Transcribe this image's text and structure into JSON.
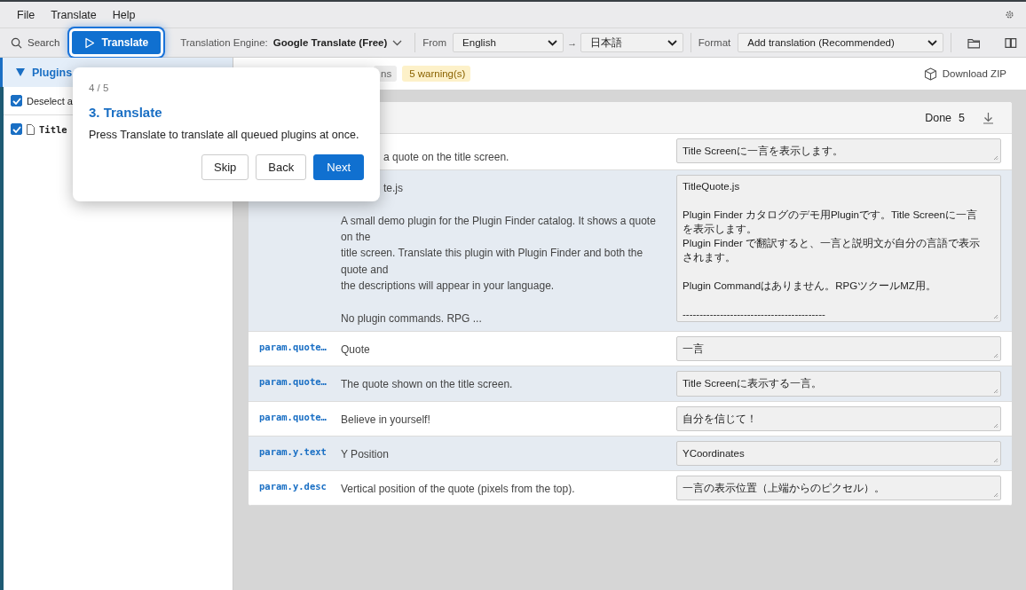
{
  "menu": [
    "File",
    "Translate",
    "Help"
  ],
  "toolbar": {
    "search": "Search",
    "translate": "Translate",
    "engine_label": "Translation Engine:",
    "engine": "Google Translate (Free)",
    "from_label": "From",
    "from": "English",
    "arrow": "→",
    "to": "日本語",
    "format_label": "Format",
    "format": "Add translation (Recommended)"
  },
  "sidebar": {
    "title": "Plugins",
    "expanded": true,
    "items": [
      {
        "label": "Deselect a",
        "checked": true,
        "kind": "toggle"
      },
      {
        "label": "Title",
        "checked": true,
        "kind": "file"
      }
    ]
  },
  "summary": {
    "chips": [
      {
        "label": "ns",
        "kind": "neutral"
      },
      {
        "label": "5 warning(s)",
        "kind": "warning"
      }
    ],
    "download": "Download ZIP"
  },
  "card": {
    "status": "Done",
    "count": "5",
    "rows": [
      {
        "key": "",
        "source": "a quote on the title screen.",
        "translation": "Title Screenに一言を表示します。"
      },
      {
        "key": "",
        "source": "te.js\n\nA small demo plugin for the Plugin Finder catalog. It shows a quote\non the\ntitle screen. Translate this plugin with Plugin Finder and both the\nquote and\nthe descriptions will appear in your language.\n\nNo plugin commands. RPG ...",
        "translation": "TitleQuote.js\n\nPlugin Finder カタログのデモ用Pluginです。Title Screenに一言を表示します。\nPlugin Finder で翻訳すると、一言と説明文が自分の言語で表示されます。\n\nPlugin Commandはありません。RPGツクールMZ用。\n\n------------------------------------------"
      },
      {
        "key": "param.quote…",
        "source": "Quote",
        "translation": "一言"
      },
      {
        "key": "param.quote…",
        "source": "The quote shown on the title screen.",
        "translation": "Title Screenに表示する一言。"
      },
      {
        "key": "param.quote…",
        "source": "Believe in yourself!",
        "translation": "自分を信じて！"
      },
      {
        "key": "param.y.text",
        "source": "Y Position",
        "translation": "YCoordinates"
      },
      {
        "key": "param.y.desc",
        "source": "Vertical position of the quote (pixels from the top).",
        "translation": "一言の表示位置（上端からのピクセル）。"
      }
    ]
  },
  "tour": {
    "step": "4 / 5",
    "title": "3. Translate",
    "body": "Press Translate to translate all queued plugins at once.",
    "buttons": [
      {
        "label": "Skip",
        "primary": false
      },
      {
        "label": "Back",
        "primary": false
      },
      {
        "label": "Next",
        "primary": true
      }
    ]
  }
}
